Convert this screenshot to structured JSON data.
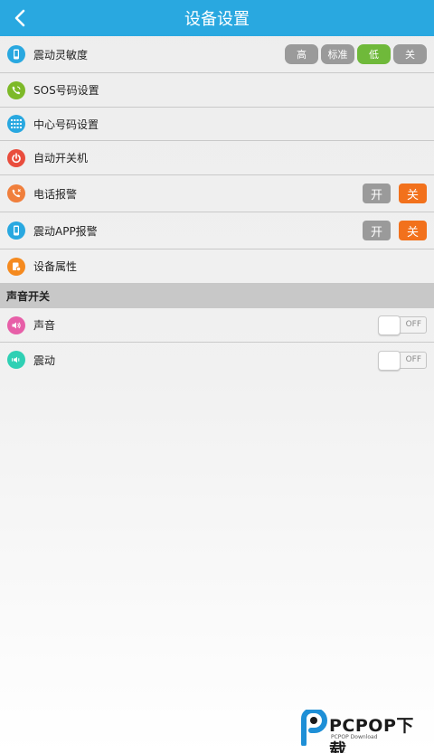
{
  "header": {
    "title": "设备设置"
  },
  "icons": {
    "back": "chevron-left-icon",
    "phone": "phone-icon",
    "sos": "phone-call-icon",
    "grid": "dialpad-icon",
    "power": "power-icon",
    "alarm": "phone-alarm-icon",
    "props": "settings-doc-icon",
    "speaker": "speaker-icon",
    "vibrate": "vibrate-icon"
  },
  "colors": {
    "accent": "#29a8e0",
    "icon_blue": "#29a8e0",
    "icon_green": "#7db928",
    "icon_red": "#e94d3d",
    "icon_orange": "#f07f3c",
    "icon_orange2": "#f58a1f",
    "icon_pink": "#e75fa8",
    "icon_teal": "#2fd0b4",
    "selected_green": "#6fb93a",
    "active_orange": "#f2711c"
  },
  "settings": {
    "sensitivity": {
      "label": "震动灵敏度",
      "options": [
        "高",
        "标准",
        "低",
        "关"
      ],
      "selected": "低"
    },
    "sos": {
      "label": "SOS号码设置"
    },
    "center": {
      "label": "中心号码设置"
    },
    "auto_power": {
      "label": "自动开关机"
    },
    "phone_alarm": {
      "label": "电话报警",
      "on": "开",
      "off": "关",
      "selected": "关"
    },
    "app_alarm": {
      "label": "震动APP报警",
      "on": "开",
      "off": "关",
      "selected": "关"
    },
    "device_props": {
      "label": "设备属性"
    }
  },
  "sound_section": {
    "title": "声音开关",
    "sound": {
      "label": "声音",
      "state": "OFF"
    },
    "vibrate": {
      "label": "震动",
      "state": "OFF"
    }
  },
  "watermark": {
    "brand": "PCPOP下载",
    "sub": "PCPOP Download"
  }
}
